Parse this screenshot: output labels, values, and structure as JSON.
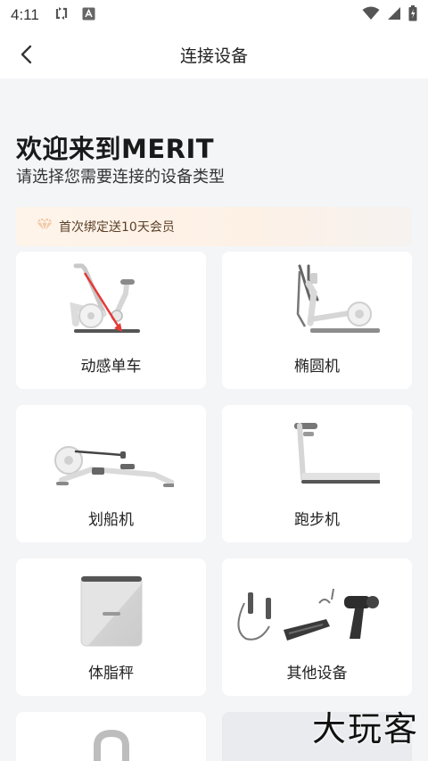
{
  "status_bar": {
    "time": "4:11"
  },
  "header": {
    "title": "连接设备"
  },
  "main": {
    "welcome": "欢迎来到MERIT",
    "subtitle": "请选择您需要连接的设备类型",
    "promo_text": "首次绑定送10天会员",
    "devices": [
      {
        "label": "动感单车",
        "icon": "exercise-bike-icon"
      },
      {
        "label": "椭圆机",
        "icon": "elliptical-icon"
      },
      {
        "label": "划船机",
        "icon": "rowing-machine-icon"
      },
      {
        "label": "跑步机",
        "icon": "treadmill-icon"
      },
      {
        "label": "体脂秤",
        "icon": "body-fat-scale-icon"
      },
      {
        "label": "其他设备",
        "icon": "other-devices-icon"
      }
    ]
  },
  "watermark": "大玩客",
  "colors": {
    "background": "#f4f5f7",
    "card": "#ffffff",
    "promo_bg": "#fff4ea",
    "arrow": "#e53935"
  }
}
